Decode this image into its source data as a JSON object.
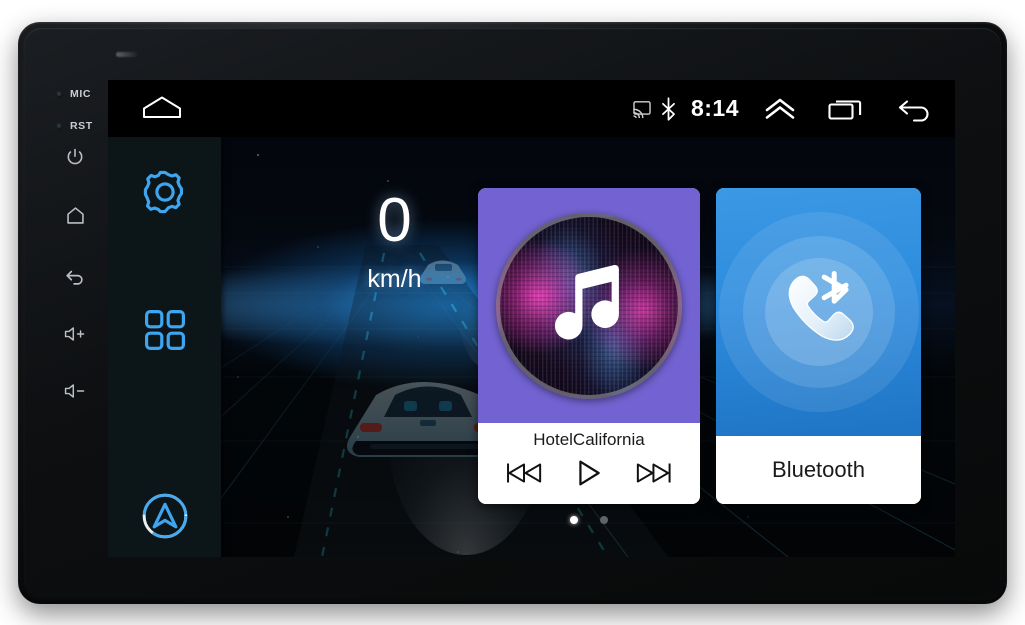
{
  "device": {
    "bezel_controls": [
      {
        "name": "mic-indicator",
        "label": "MIC",
        "type": "led"
      },
      {
        "name": "reset-indicator",
        "label": "RST",
        "type": "led"
      },
      {
        "name": "power-button",
        "label": "power-icon"
      },
      {
        "name": "home-button",
        "label": "home-icon"
      },
      {
        "name": "back-button",
        "label": "back-icon"
      },
      {
        "name": "volume-up",
        "label": "volume-up-icon"
      },
      {
        "name": "volume-down",
        "label": "volume-down-icon"
      }
    ],
    "led_labels": {
      "mic": "MIC",
      "rst": "RST"
    }
  },
  "statusbar": {
    "home_icon": "home-icon",
    "time": "8:14",
    "icons": [
      "cast-icon",
      "bluetooth-icon"
    ],
    "nav_icons": [
      "chevron-up-icon",
      "recents-icon",
      "back-icon"
    ]
  },
  "sidebar": {
    "items": [
      {
        "name": "settings",
        "icon": "gear-icon"
      },
      {
        "name": "apps",
        "icon": "apps-grid-icon"
      },
      {
        "name": "navigation",
        "icon": "navigation-arrow-icon"
      }
    ]
  },
  "speedometer": {
    "value": "0",
    "unit": "km/h"
  },
  "widgets": {
    "music": {
      "title": "HotelCalifornia",
      "art_icon": "music-note-icon",
      "accent": "#7363d2",
      "controls": [
        {
          "name": "previous-track",
          "icon": "skip-previous-icon"
        },
        {
          "name": "play",
          "icon": "play-icon"
        },
        {
          "name": "next-track",
          "icon": "skip-next-icon"
        }
      ]
    },
    "bluetooth": {
      "label": "Bluetooth",
      "art_icon": "phone-bluetooth-icon",
      "accent": "#2e8cde"
    }
  },
  "page_indicator": {
    "total": 2,
    "active": 1
  },
  "colors": {
    "music_accent": "#7363d2",
    "bluetooth_accent": "#2e8cde",
    "sidebar_bg": "#0c1619",
    "status_bg": "#000000",
    "icon_blue": "#3ea6f0"
  }
}
